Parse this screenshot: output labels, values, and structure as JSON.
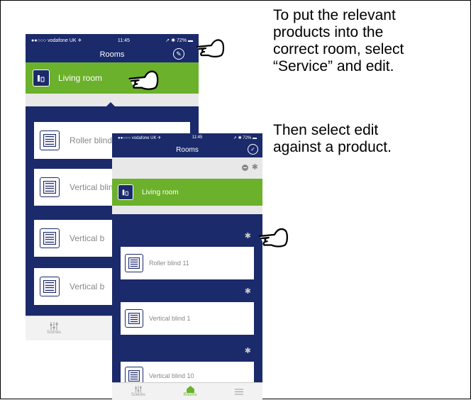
{
  "back_phone": {
    "status": {
      "carrier": "●●○○○ vodafone UK ✈",
      "time": "11:45",
      "battery": "72%"
    },
    "title": "Rooms",
    "room_name": "Living room",
    "products": [
      "Roller blind",
      "Vertical blind",
      "Vertical b",
      "Vertical b"
    ],
    "tabs": [
      {
        "label": "Scenes",
        "icon": "sliders-icon"
      }
    ]
  },
  "front_phone": {
    "status": {
      "carrier": "●●○○○ vodafone UK ✈",
      "time": "11:45",
      "battery": "72%"
    },
    "title": "Rooms",
    "room_name": "Living room",
    "products": [
      "Roller blind 11",
      "Vertical blind 1",
      "Vertical blind 10"
    ],
    "tabs": [
      {
        "label": "Scenes",
        "icon": "sliders-icon"
      },
      {
        "label": "Rooms",
        "icon": "home-icon"
      },
      {
        "label": "",
        "icon": "menu-icon"
      }
    ]
  },
  "instructions": {
    "line1": "To put the relevant",
    "line2": "products into the",
    "line3": "correct room, select",
    "line4": "“Service” and edit.",
    "line5": "Then select edit",
    "line6": "against a product."
  },
  "colors": {
    "navy": "#1b2a6b",
    "green": "#6bb12b",
    "grey": "#e8e8e8"
  }
}
